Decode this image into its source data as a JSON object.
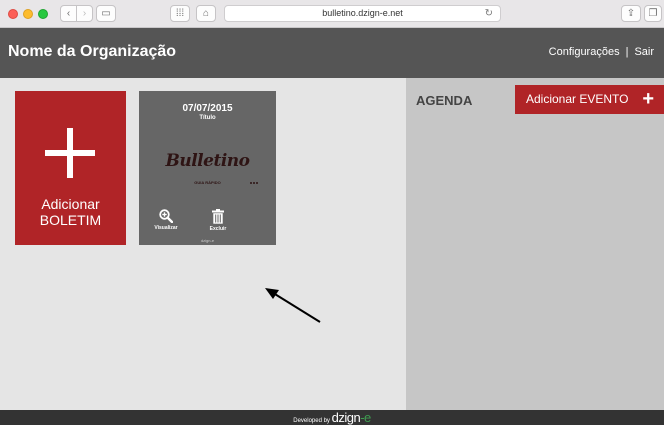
{
  "browser": {
    "url": "bulletino.dzign-e.net",
    "icons": [
      "chevron-left-icon",
      "chevron-right-icon",
      "sidebar-icon",
      "grid-icon",
      "home-icon",
      "reload-icon",
      "share-icon",
      "tabs-icon"
    ]
  },
  "header": {
    "org_name": "Nome da Organização",
    "settings_link": "Configurações",
    "separator": "|",
    "logout_link": "Sair"
  },
  "main": {
    "add_bulletin": {
      "line1": "Adicionar",
      "line2": "BOLETIM"
    },
    "bulletins": [
      {
        "date": "07/07/2015",
        "title": "Título",
        "logo_text": "Bulletino",
        "guide_text": "GUIA RÁPIDO",
        "view_label": "Visualizar",
        "delete_label": "Excluir",
        "brand_text": "dzign-e"
      }
    ]
  },
  "agenda": {
    "title": "AGENDA",
    "add_event_label": "Adicionar  EVENTO",
    "add_event_plus": "+"
  },
  "footer": {
    "developed_by": "Developed by",
    "brand": "dzign",
    "brand_suffix": "-e"
  },
  "colors": {
    "accent_red": "#b02427",
    "header_gray": "#555555",
    "card_gray": "#666666",
    "agenda_gray": "#c6c6c6",
    "footer_dark": "#333333"
  }
}
